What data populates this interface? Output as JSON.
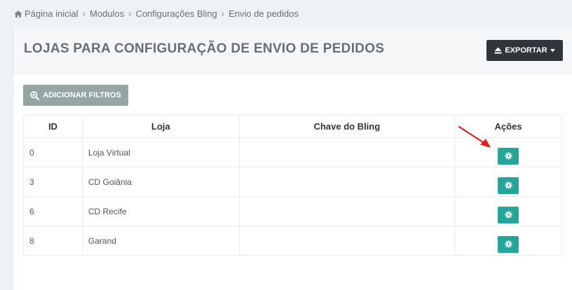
{
  "breadcrumb": {
    "icon": "home-icon",
    "items": [
      "Página inicial",
      "Modulos",
      "Configurações Bling",
      "Envio de pedidos"
    ]
  },
  "page": {
    "title": "LOJAS PARA CONFIGURAÇÃO DE ENVIO DE PEDIDOS"
  },
  "toolbar": {
    "export_label": "EXPORTAR",
    "export_icon": "eject-icon",
    "filter_label": "ADICIONAR FILTROS",
    "filter_icon": "zoom-in-icon"
  },
  "table": {
    "columns": [
      "ID",
      "Loja",
      "Chave do Bling",
      "Ações"
    ],
    "rows": [
      {
        "id": "0",
        "store": "Loja Virtual",
        "key": ""
      },
      {
        "id": "3",
        "store": "CD Goiânia",
        "key": ""
      },
      {
        "id": "6",
        "store": "CD Recife",
        "key": ""
      },
      {
        "id": "8",
        "store": "Garand",
        "key": ""
      }
    ],
    "action_icon": "gear-icon"
  },
  "colors": {
    "action_button": "#26a69a",
    "export_button": "#2f353b",
    "filter_button": "#95a5a6",
    "annotation_arrow": "#e02020"
  }
}
